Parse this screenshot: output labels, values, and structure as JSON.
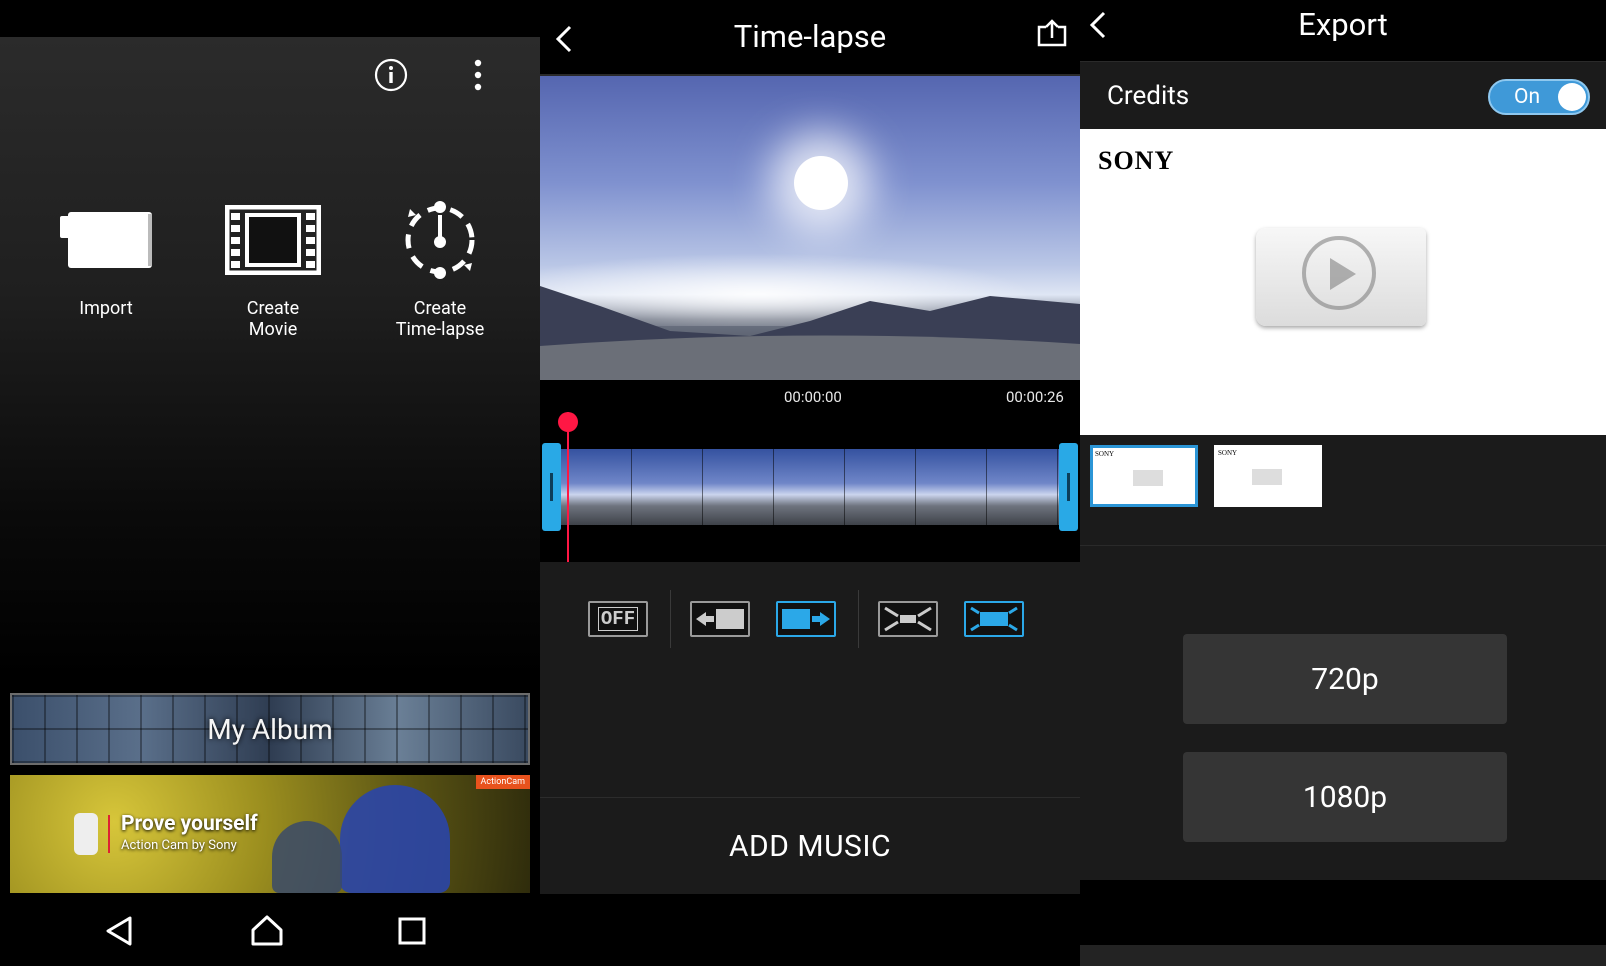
{
  "home": {
    "menu_items": [
      {
        "label": "Import",
        "icon": "camera-icon"
      },
      {
        "label": "Create\nMovie",
        "icon": "film-icon"
      },
      {
        "label": "Create\nTime-lapse",
        "icon": "timelapse-icon"
      }
    ],
    "album_title": "My Album",
    "ad": {
      "headline": "Prove yourself",
      "subline": "Action Cam by Sony",
      "badge": "ActionCam"
    }
  },
  "timelapse": {
    "title": "Time-lapse",
    "start_time": "00:00:00",
    "end_time": "00:00:26",
    "controls": [
      "OFF"
    ],
    "add_music_label": "ADD MUSIC"
  },
  "export": {
    "title": "Export",
    "credits_label": "Credits",
    "credits_toggle": "On",
    "brand": "SONY",
    "thumb_brand": "SONY",
    "resolutions": [
      "720p",
      "1080p"
    ]
  },
  "colors": {
    "accent": "#29a9e6",
    "playhead": "#ff1744",
    "toggle_on": "#3f99d8"
  }
}
